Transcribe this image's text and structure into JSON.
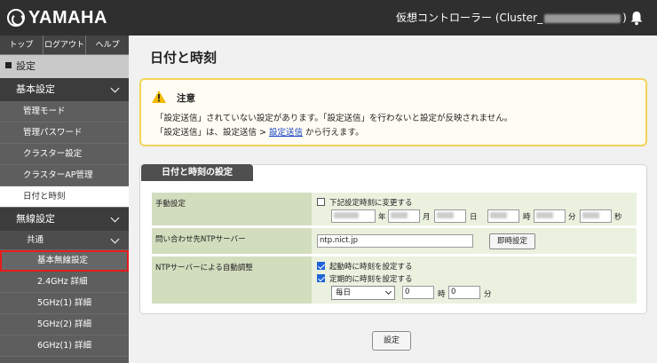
{
  "header": {
    "brand": "YAMAHA",
    "controller_label_prefix": "仮想コントローラー (Cluster_",
    "controller_label_suffix": ")"
  },
  "sidebar": {
    "top_links": [
      "トップ",
      "ログアウト",
      "ヘルプ"
    ],
    "section": "設定",
    "basic_group": "基本設定",
    "basic_items": [
      "管理モード",
      "管理パスワード",
      "クラスター設定",
      "クラスターAP管理",
      "日付と時刻"
    ],
    "wireless_group": "無線設定",
    "common_sub": "共通",
    "wireless_items": [
      "基本無線設定",
      "2.4GHz 詳細",
      "5GHz(1) 詳細",
      "5GHz(2) 詳細",
      "6GHz(1) 詳細"
    ]
  },
  "main": {
    "title": "日付と時刻",
    "notice": {
      "title": "注意",
      "line1": "「設定送信」されていない設定があります。「設定送信」を行わないと設定が反映されません。",
      "line2_prefix": "「設定送信」は、設定送信 > ",
      "line2_link": "設定送信",
      "line2_suffix": " から行えます。"
    },
    "panel_title": "日付と時刻の設定",
    "manual": {
      "label": "手動設定",
      "checkbox_label": "下記設定時刻に変更する",
      "units": [
        "年",
        "月",
        "日",
        "時",
        "分",
        "秒"
      ]
    },
    "ntp_server": {
      "label": "問い合わせ先NTPサーバー",
      "value": "ntp.nict.jp",
      "button": "即時設定"
    },
    "auto_adjust": {
      "label": "NTPサーバーによる自動調整",
      "check_boot": "起動時に時刻を設定する",
      "check_periodic": "定期的に時刻を設定する",
      "interval": "毎日",
      "hour_value": "0",
      "hour_unit": "時",
      "minute_value": "0",
      "minute_unit": "分"
    },
    "save_button": "設定"
  }
}
